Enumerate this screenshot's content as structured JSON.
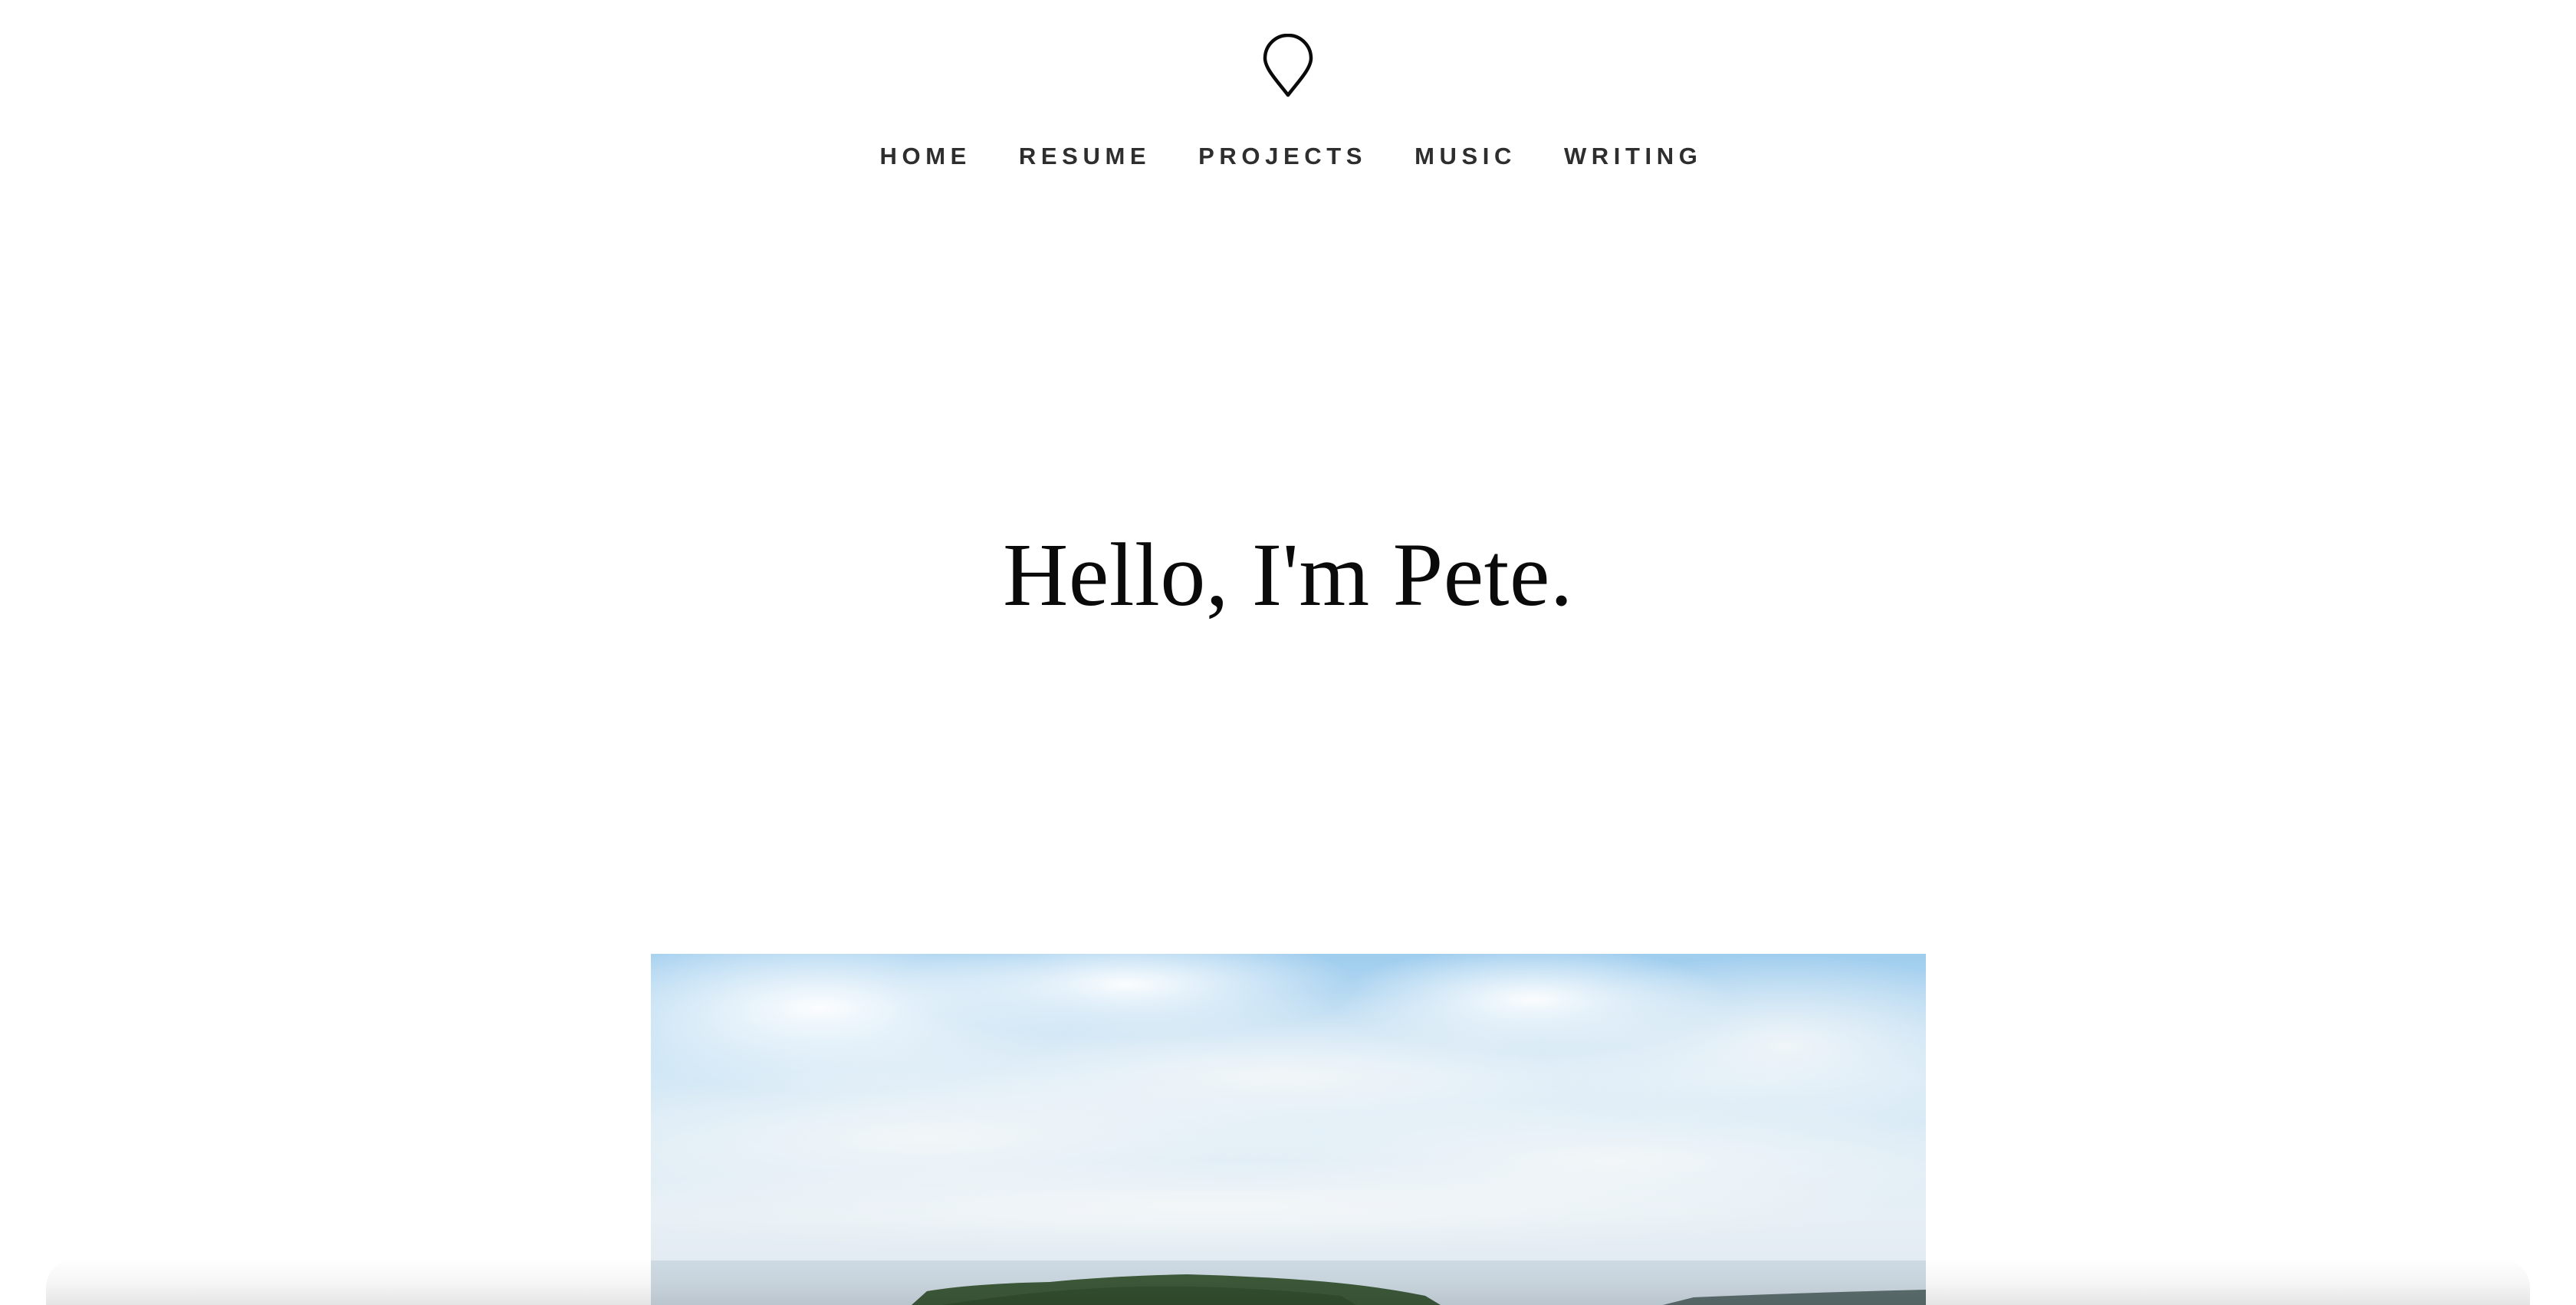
{
  "header": {
    "logo_icon": "map-pin-icon",
    "nav": [
      {
        "label": "HOME"
      },
      {
        "label": "RESUME"
      },
      {
        "label": "PROJECTS"
      },
      {
        "label": "MUSIC"
      },
      {
        "label": "WRITING"
      }
    ]
  },
  "hero": {
    "title": "Hello, I'm Pete."
  },
  "colors": {
    "background": "#ffffff",
    "nav_text": "#2e2e2e",
    "title_text": "#0a0a0a",
    "sky": "#a9d3ef",
    "forest": "#3d5a3a"
  }
}
